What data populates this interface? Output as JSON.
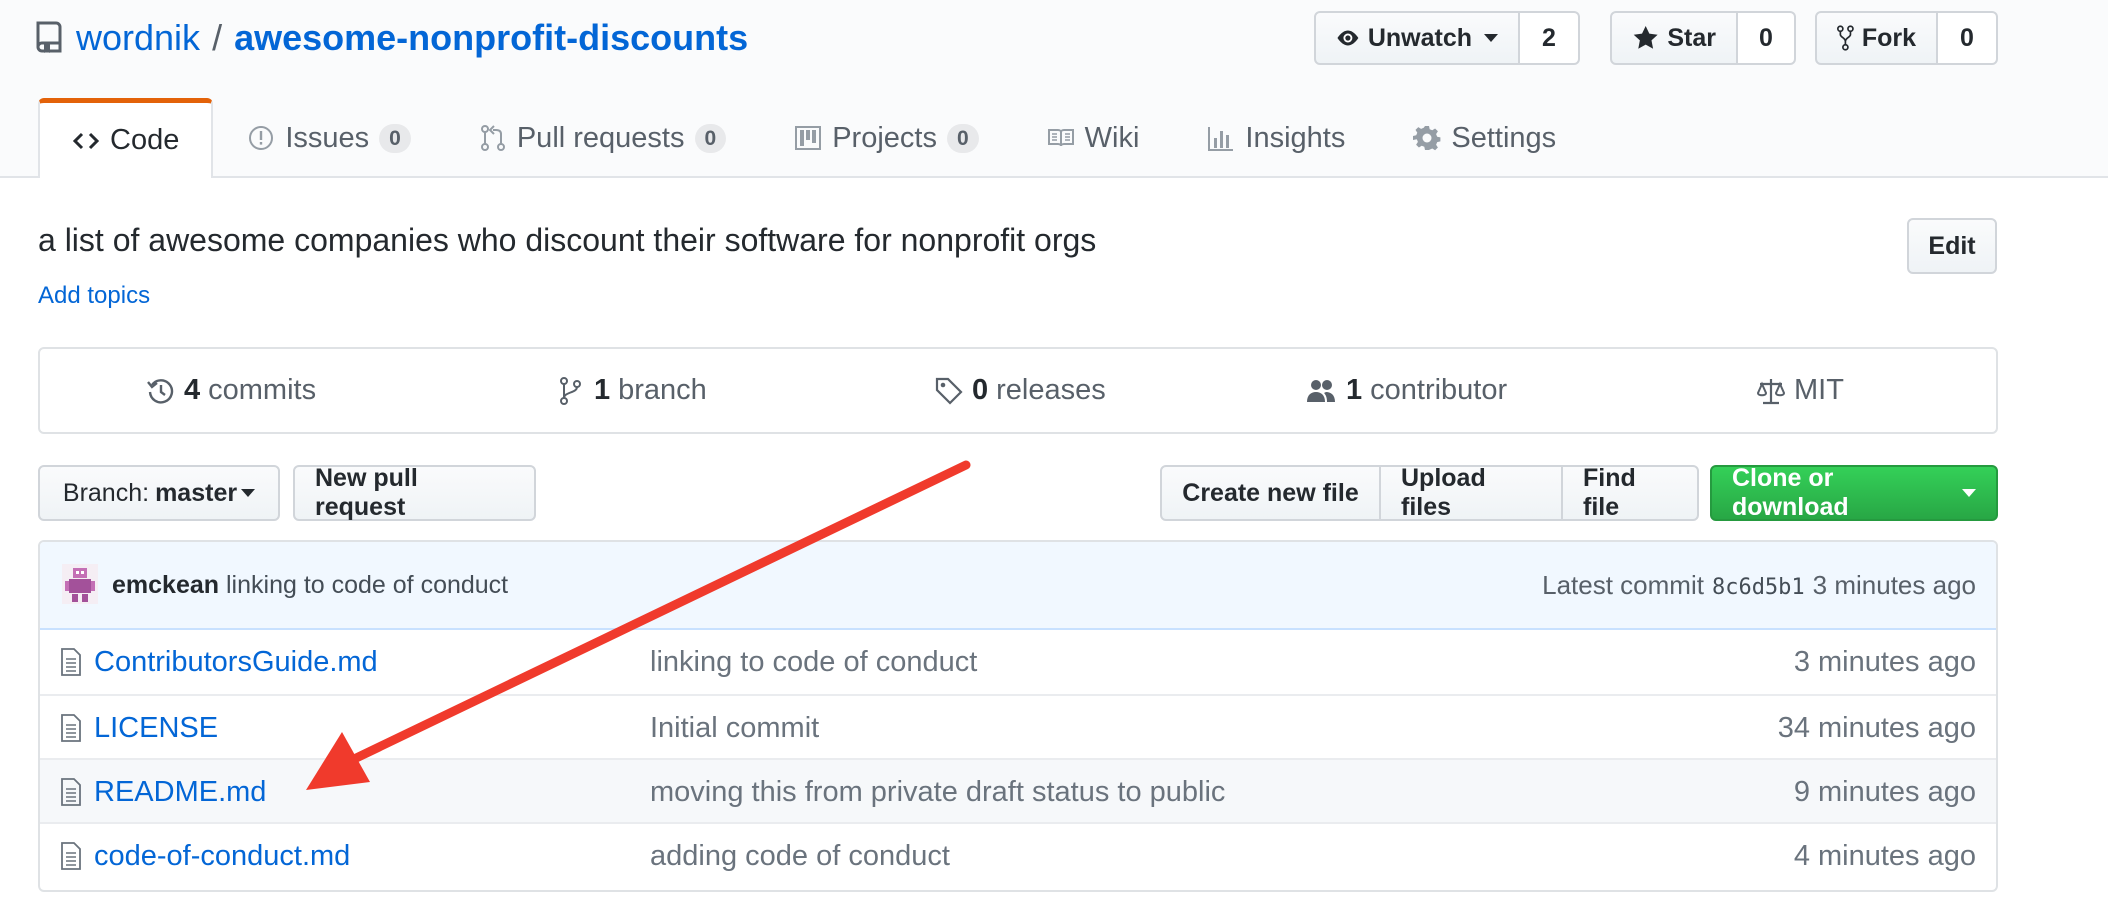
{
  "repo": {
    "owner": "wordnik",
    "separator": "/",
    "name": "awesome-nonprofit-discounts"
  },
  "actions": {
    "watch": {
      "label": "Unwatch",
      "count": "2"
    },
    "star": {
      "label": "Star",
      "count": "0"
    },
    "fork": {
      "label": "Fork",
      "count": "0"
    }
  },
  "nav": {
    "code": {
      "label": "Code"
    },
    "issues": {
      "label": "Issues",
      "count": "0"
    },
    "pulls": {
      "label": "Pull requests",
      "count": "0"
    },
    "projects": {
      "label": "Projects",
      "count": "0"
    },
    "wiki": {
      "label": "Wiki"
    },
    "insights": {
      "label": "Insights"
    },
    "settings": {
      "label": "Settings"
    }
  },
  "description": {
    "text": "a list of awesome companies who discount their software for nonprofit orgs",
    "add_topics": "Add topics",
    "edit": "Edit"
  },
  "summary": {
    "commits": {
      "num": "4",
      "label": "commits"
    },
    "branches": {
      "num": "1",
      "label": "branch"
    },
    "releases": {
      "num": "0",
      "label": "releases"
    },
    "contributors": {
      "num": "1",
      "label": "contributor"
    },
    "license": {
      "label": "MIT"
    }
  },
  "file_nav": {
    "branch_prefix": "Branch:",
    "branch_name": "master",
    "new_pr": "New pull request",
    "create_file": "Create new file",
    "upload_files": "Upload files",
    "find_file": "Find file",
    "clone": "Clone or download"
  },
  "latest_commit": {
    "author": "emckean",
    "message": "linking to code of conduct",
    "prefix": "Latest commit",
    "sha": "8c6d5b1",
    "age": "3 minutes ago"
  },
  "files": [
    {
      "name": "ContributorsGuide.md",
      "message": "linking to code of conduct",
      "age": "3 minutes ago"
    },
    {
      "name": "LICENSE",
      "message": "Initial commit",
      "age": "34 minutes ago"
    },
    {
      "name": "README.md",
      "message": "moving this from private draft status to public",
      "age": "9 minutes ago"
    },
    {
      "name": "code-of-conduct.md",
      "message": "adding code of conduct",
      "age": "4 minutes ago"
    }
  ],
  "colors": {
    "link": "#0366d6",
    "tab_accent": "#e36209",
    "clone_green": "#28a745",
    "annotation_red": "#f03a2c"
  }
}
